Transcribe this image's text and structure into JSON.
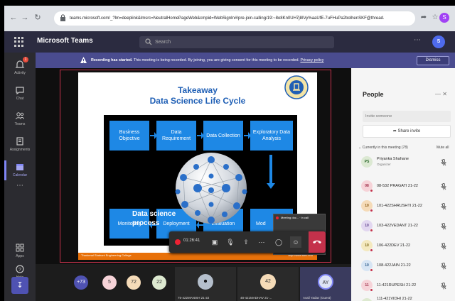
{
  "browser": {
    "url": "teams.microsoft.com/_?lm=deeplink&lmsrc=NeutralHomePageWeb&cmpid=WebSignIn#/pre-join-calling/19:~8o8Kn0UH7j8IVy%aaUfE-7uFHuPa2bolhenSKF@thread.",
    "profile_initial": "S"
  },
  "header": {
    "app_title": "Microsoft Teams",
    "search_placeholder": "Search",
    "user_initials": "S"
  },
  "rail": {
    "items": [
      {
        "label": "Activity",
        "badge": "1"
      },
      {
        "label": "Chat"
      },
      {
        "label": "Teams"
      },
      {
        "label": "Assignments"
      },
      {
        "label": "Calendar"
      },
      {
        "label": "Apps"
      },
      {
        "label": "Help"
      }
    ]
  },
  "banner": {
    "title": "Recording has started.",
    "message": " This meeting is being recorded. By joining, you are giving consent for this meeting to be recorded.",
    "link": "Privacy policy",
    "dismiss": "Dismiss"
  },
  "slide": {
    "title_line1": "Takeaway",
    "title_line2": "Data Science Life Cycle",
    "boxes": [
      "Business Objective",
      "Data Requirement",
      "Data Collection",
      "Exploratory Data Analysis",
      "Monitoring",
      "Deployment",
      "Evaluation",
      "Mod"
    ],
    "center_text_1": "Data science",
    "center_text_2": "process",
    "footer_left": "Thadomal Shahani Engineering College",
    "footer_right": "http://www.tsec.edu"
  },
  "controls": {
    "timer": "01:26:41"
  },
  "mini_tile": {
    "label": "Meeting doc... · in call"
  },
  "strip": {
    "counters": [
      "+73",
      "5",
      "72",
      "22"
    ],
    "tiles": [
      {
        "name": "75-422MANISH 21-22"
      },
      {
        "initials": "42",
        "name": "48-421MADHAV 21-..."
      },
      {
        "initials": "AY",
        "name": "Avail Yadav (Guest)"
      }
    ]
  },
  "people": {
    "title": "People",
    "invite_placeholder": "Invite someone",
    "share_invite": "Share invite",
    "current_label": "Currently in this meeting (78)",
    "mute_all": "Mute all",
    "participants": [
      {
        "initials": "PS",
        "name": "Priyanka Shahane",
        "role": "Organizer",
        "color": "#dce9d3"
      },
      {
        "initials": "08",
        "name": "08-532 PRAGATI 21-22",
        "color": "#f6d3d8"
      },
      {
        "initials": "10",
        "name": "101-422SHRUSHTI 21-22",
        "color": "#f5dbb8"
      },
      {
        "initials": "10",
        "name": "103-422VEDANT 21-22",
        "color": "#e2d7f0"
      },
      {
        "initials": "10",
        "name": "106-422DEV 21-22",
        "color": "#f4e9bf"
      },
      {
        "initials": "10",
        "name": "108-422JAIN 21-22",
        "color": "#d7e5f4"
      },
      {
        "initials": "11",
        "name": "11-421RUPESH 21-22",
        "color": "#f6d3d8"
      },
      {
        "initials": "11",
        "name": "111-421VIDHI 21-22",
        "color": "#dde9d0"
      }
    ]
  }
}
